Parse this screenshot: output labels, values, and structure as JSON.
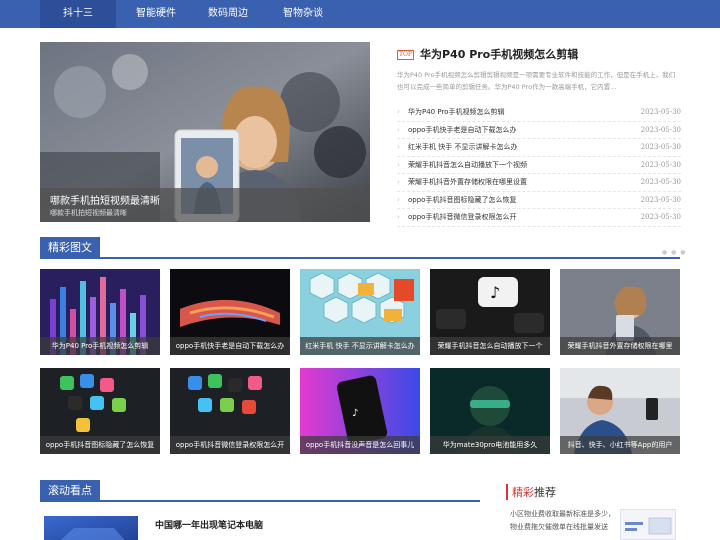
{
  "nav": {
    "items": [
      {
        "label": "抖十三"
      },
      {
        "label": "智能硬件"
      },
      {
        "label": "数码周边"
      },
      {
        "label": "智物杂谈"
      }
    ]
  },
  "hero": {
    "title": "哪款手机拍短视频最清晰",
    "subtitle": "哪款手机拍短视频最清晰"
  },
  "top_news": {
    "tag": "TOP",
    "title": "华为P40 Pro手机视频怎么剪辑",
    "description": "华为P40 Pro手机视频怎么剪辑剪辑视频是一项需要专业软件和技能的工作，但是在手机上，我们也可以完成一些简单的剪辑任务。华为P40 Pro作为一款高端手机，它内置..."
  },
  "news_list": [
    {
      "title": "华为P40 Pro手机视频怎么剪辑",
      "date": "2023-05-30"
    },
    {
      "title": "oppo手机快手老是自动下载怎么办",
      "date": "2023-05-30"
    },
    {
      "title": "红米手机 快手 不显示讲解卡怎么办",
      "date": "2023-05-30"
    },
    {
      "title": "荣耀手机抖音怎么自动播放下一个视频",
      "date": "2023-05-30"
    },
    {
      "title": "荣耀手机抖音外置存储权限在哪里设置",
      "date": "2023-05-30"
    },
    {
      "title": "oppo手机抖音图标隐藏了怎么恢复",
      "date": "2023-05-30"
    },
    {
      "title": "oppo手机抖音微信登录权限怎么开",
      "date": "2023-05-30"
    }
  ],
  "section1": {
    "title": "精彩图文",
    "more": "● ● ●"
  },
  "cards": [
    {
      "label": "华为P40 Pro手机视频怎么剪辑"
    },
    {
      "label": "oppo手机快手老是自动下载怎么办"
    },
    {
      "label": "红米手机 快手 不显示讲解卡怎么办"
    },
    {
      "label": "荣耀手机抖音怎么自动播放下一个"
    },
    {
      "label": "荣耀手机抖音外置存储权限在哪里"
    },
    {
      "label": "oppo手机抖音图标隐藏了怎么恢复"
    },
    {
      "label": "oppo手机抖音微信登录权限怎么开"
    },
    {
      "label": "oppo手机抖音没声音是怎么回事儿"
    },
    {
      "label": "华为mate30pro电池能用多久"
    },
    {
      "label": "抖音、快手、小红书等App的用户"
    }
  ],
  "section2": {
    "title": "滚动看点"
  },
  "scroll": {
    "title": "中国哪一年出现笔记本电脑"
  },
  "recommend": {
    "title_highlight": "精彩",
    "title_rest": "推荐",
    "text": "小区物业费收取最新标准是多少，物业费拖欠催缴单在线批量发送"
  },
  "colors": {
    "accent": "#3a60b0",
    "highlight": "#dd3333"
  }
}
